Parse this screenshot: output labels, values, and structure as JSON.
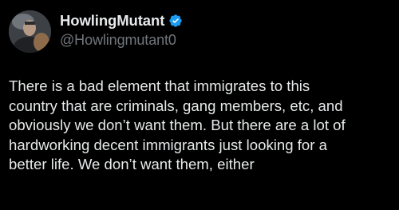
{
  "author": {
    "display_name": "HowlingMutant",
    "handle": "@Howlingmutant0",
    "verified": true,
    "avatar_icon": "profile-photo-avatar"
  },
  "tweet": {
    "lines": [
      "There is a bad element that immigrates to this",
      "country that are criminals, gang members, etc, and",
      "obviously we don’t want them.  But there are a lot of",
      "hardworking decent immigrants just looking for a",
      "better life.  We don’t want them, either"
    ]
  },
  "colors": {
    "background": "#000000",
    "text": "#e7e9ea",
    "handle": "#71767b",
    "verified_badge": "#1d9bf0"
  }
}
